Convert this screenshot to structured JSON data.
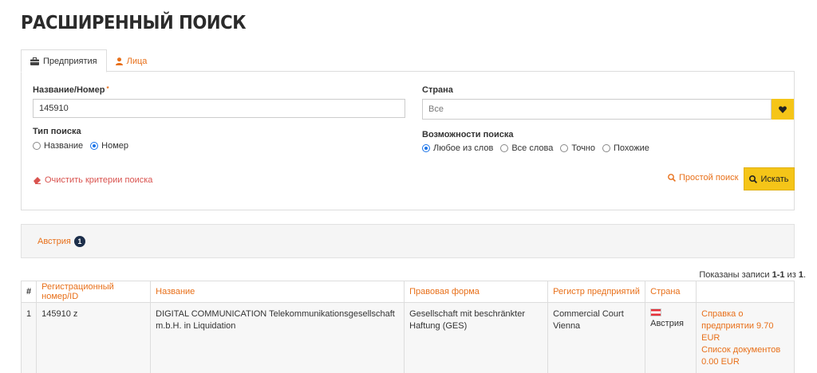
{
  "page": {
    "title": "РАСШИРЕННЫЙ ПОИСК"
  },
  "tabs": [
    {
      "label": "Предприятия",
      "icon": "briefcase-icon",
      "active": true
    },
    {
      "label": "Лица",
      "icon": "person-icon",
      "active": false
    }
  ],
  "form": {
    "name_label": "Название/Номер",
    "required_mark": "*",
    "name_value": "145910",
    "search_type_label": "Тип поиска",
    "search_type_options": [
      "Название",
      "Номер"
    ],
    "search_type_selected": "Номер",
    "country_label": "Страна",
    "country_value": "Все",
    "search_options_label": "Возможности поиска",
    "search_options": [
      "Любое из слов",
      "Все слова",
      "Точно",
      "Похожие"
    ],
    "search_options_selected": "Любое из слов",
    "clear_label": "Очистить критерии поиска",
    "simple_search_label": "Простой поиск",
    "search_button_label": "Искать"
  },
  "facets": [
    {
      "label": "Австрия",
      "count": "1"
    }
  ],
  "results": {
    "count_prefix": "Показаны записи",
    "count_range": "1-1",
    "count_mid": "из",
    "count_total": "1",
    "count_suffix": ".",
    "columns": [
      "#",
      "Регистрационный номер/ID",
      "Название",
      "Правовая форма",
      "Регистр предприятий",
      "Страна",
      ""
    ],
    "rows": [
      {
        "index": "1",
        "reg_number": "145910 z",
        "name": "DIGITAL COMMUNICATION Telekommunikationsgesellschaft m.b.H. in Liquidation",
        "legal_form": "Gesellschaft mit beschränkter Haftung (GES)",
        "registry": "Commercial Court Vienna",
        "country": "Австрия",
        "action_1": "Справка о предприятии 9.70 EUR",
        "action_2": "Список документов 0.00 EUR"
      }
    ]
  },
  "colors": {
    "accent": "#e8701a",
    "button": "#f5c518",
    "danger": "#d9534f",
    "radio": "#1a73e8",
    "badge": "#1c2e4a"
  }
}
